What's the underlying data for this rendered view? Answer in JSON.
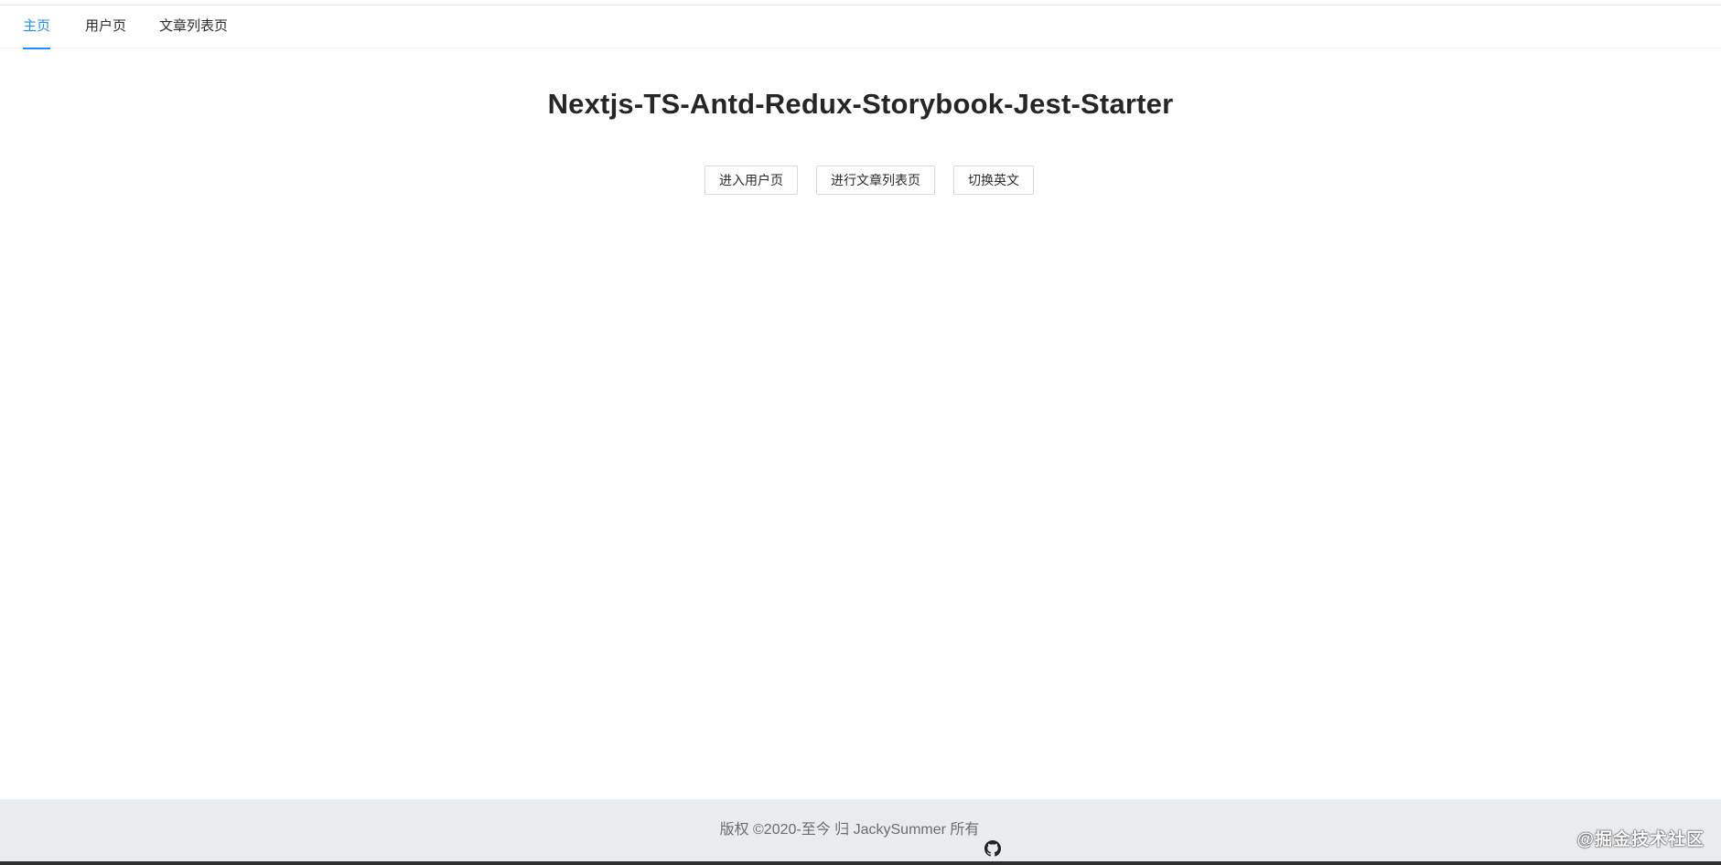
{
  "nav": {
    "items": [
      {
        "label": "主页",
        "active": true
      },
      {
        "label": "用户页",
        "active": false
      },
      {
        "label": "文章列表页",
        "active": false
      }
    ]
  },
  "main": {
    "title": "Nextjs-TS-Antd-Redux-Storybook-Jest-Starter",
    "buttons": [
      {
        "label": "进入用户页"
      },
      {
        "label": "进行文章列表页"
      },
      {
        "label": "切换英文"
      }
    ]
  },
  "footer": {
    "text": "版权 ©2020-至今 归 JackySummer 所有",
    "icon": "github-icon"
  },
  "watermark": {
    "text": "@掘金技术社区"
  },
  "colors": {
    "accent": "#1890ff",
    "footer_bg": "#e9ecef",
    "text": "#262626"
  }
}
